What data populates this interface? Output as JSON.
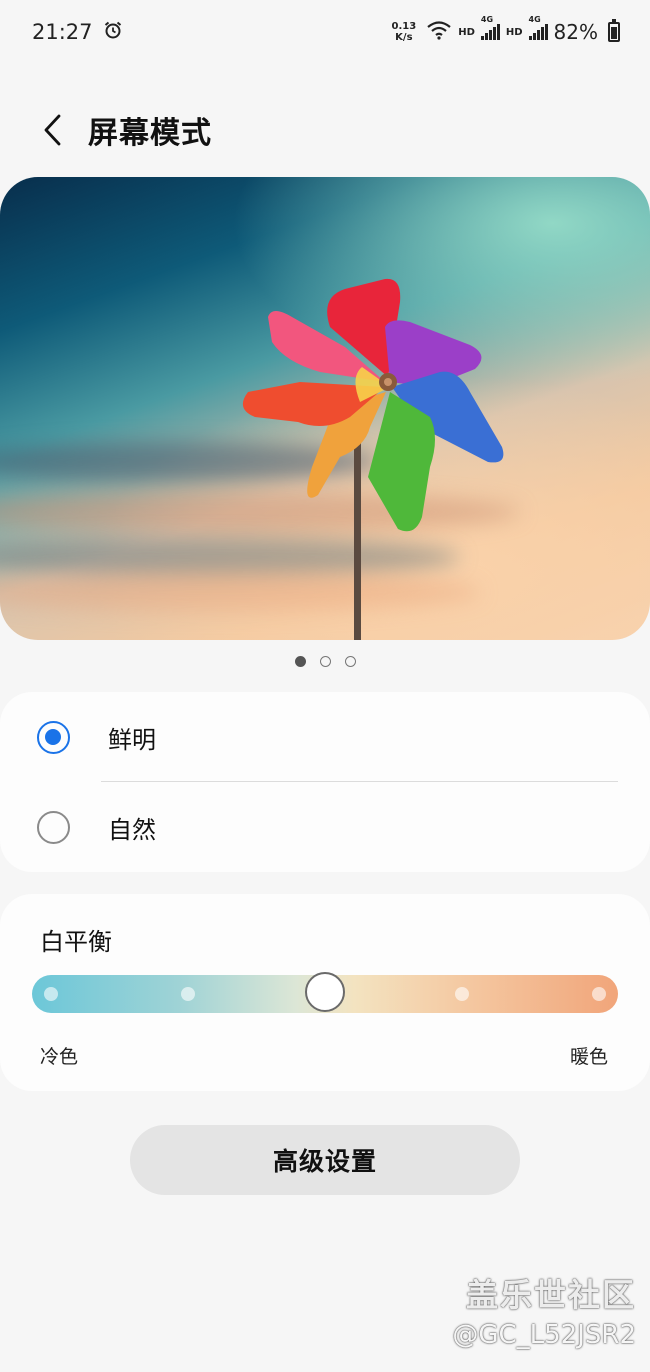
{
  "status_bar": {
    "time": "21:27",
    "net_speed_value": "0.13",
    "net_speed_unit": "K/s",
    "hd1": "HD",
    "sim1": "4G",
    "hd2": "HD",
    "sim2": "4G",
    "battery": "82%"
  },
  "header": {
    "title": "屏幕模式"
  },
  "preview": {
    "page_count": 3,
    "active_page": 1
  },
  "modes": {
    "selected": "鲜明",
    "options": [
      {
        "label": "鲜明",
        "checked": true
      },
      {
        "label": "自然",
        "checked": false
      }
    ]
  },
  "white_balance": {
    "title": "白平衡",
    "cool_label": "冷色",
    "warm_label": "暖色",
    "steps": 5,
    "value": 3,
    "colors": {
      "cool": "#6cc7d8",
      "neutral": "#f3e3c0",
      "warm": "#f1a57a"
    }
  },
  "advanced": {
    "label": "高级设置"
  },
  "watermark": {
    "title": "盖乐世社区",
    "user": "@GC_L52JSR2"
  },
  "colors": {
    "accent": "#1a73e8",
    "background": "#f6f6f6",
    "card": "#fdfdfd"
  }
}
